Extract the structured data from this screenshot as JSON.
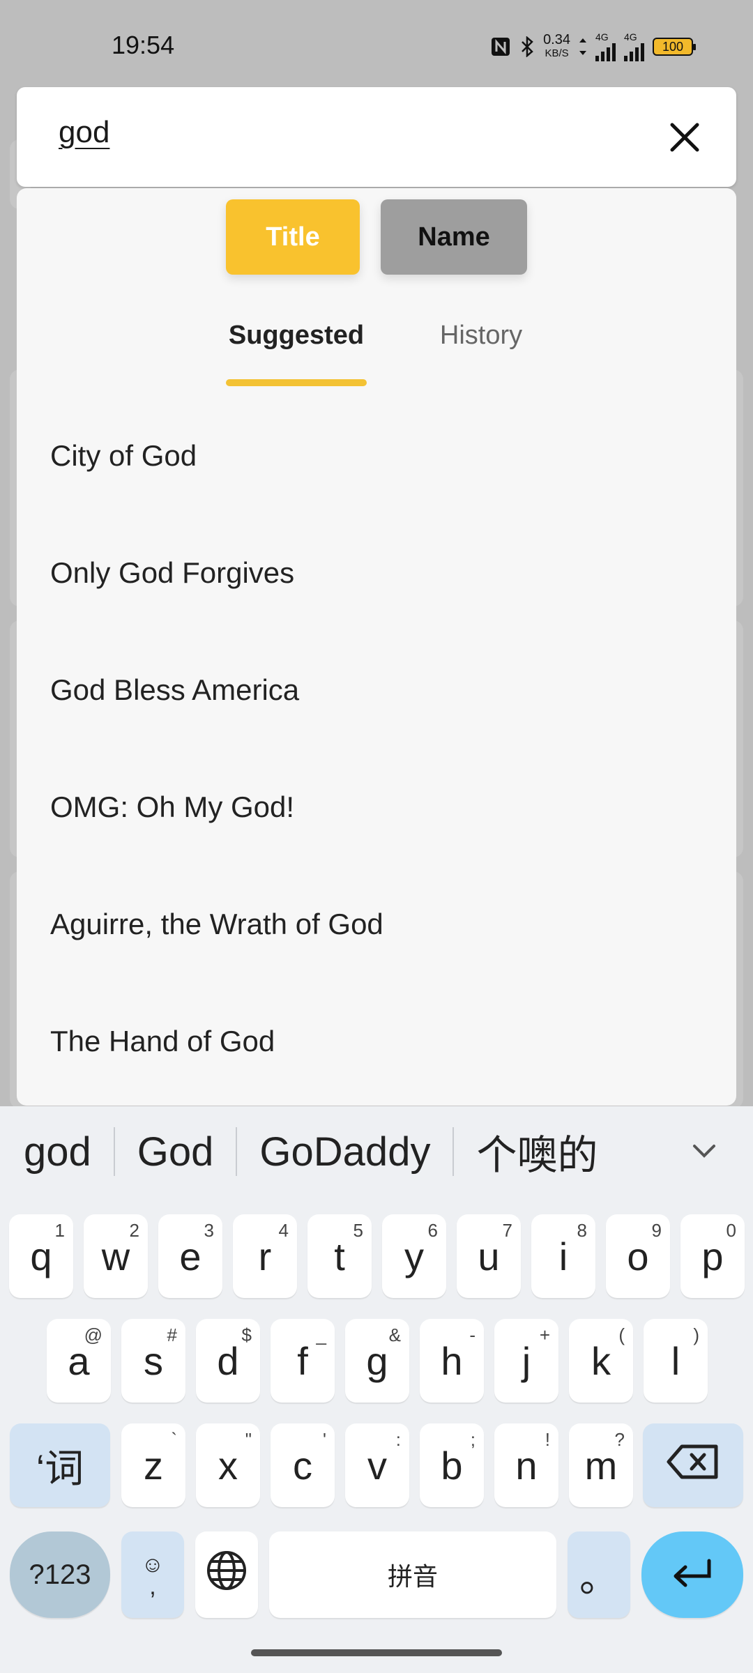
{
  "status": {
    "time": "19:54",
    "speed_value": "0.34",
    "speed_unit": "KB/S",
    "network": "4G",
    "network2": "4G",
    "battery": "100"
  },
  "search": {
    "query": "god"
  },
  "filters": {
    "title": "Title",
    "name": "Name",
    "active": "Title"
  },
  "tabs": {
    "suggested": "Suggested",
    "history": "History",
    "active": "Suggested"
  },
  "suggestions": [
    "City of God",
    "Only God Forgives",
    "God Bless America",
    "OMG: Oh My God!",
    "Aguirre, the Wrath of God",
    "The Hand of God"
  ],
  "keyboard": {
    "candidates": [
      "god",
      "God",
      "GoDaddy",
      "个噢的"
    ],
    "row1": [
      {
        "k": "q",
        "h": "1"
      },
      {
        "k": "w",
        "h": "2"
      },
      {
        "k": "e",
        "h": "3"
      },
      {
        "k": "r",
        "h": "4"
      },
      {
        "k": "t",
        "h": "5"
      },
      {
        "k": "y",
        "h": "6"
      },
      {
        "k": "u",
        "h": "7"
      },
      {
        "k": "i",
        "h": "8"
      },
      {
        "k": "o",
        "h": "9"
      },
      {
        "k": "p",
        "h": "0"
      }
    ],
    "row2": [
      {
        "k": "a",
        "h": "@"
      },
      {
        "k": "s",
        "h": "#"
      },
      {
        "k": "d",
        "h": "$"
      },
      {
        "k": "f",
        "h": "_"
      },
      {
        "k": "g",
        "h": "&"
      },
      {
        "k": "h",
        "h": "-"
      },
      {
        "k": "j",
        "h": "+"
      },
      {
        "k": "k",
        "h": "("
      },
      {
        "k": "l",
        "h": ")"
      }
    ],
    "row3": [
      {
        "k": "z",
        "h": "`"
      },
      {
        "k": "x",
        "h": "\""
      },
      {
        "k": "c",
        "h": "'"
      },
      {
        "k": "v",
        "h": ":"
      },
      {
        "k": "b",
        "h": ";"
      },
      {
        "k": "n",
        "h": "!"
      },
      {
        "k": "m",
        "h": "?"
      }
    ],
    "ci_key": "‘词",
    "num_key": "?123",
    "emoji_hint": "☺",
    "emoji_key": ",",
    "space_label": "拼音",
    "period_key": "。"
  },
  "colors": {
    "accent": "#f9c22e",
    "enter": "#63c8f7"
  }
}
